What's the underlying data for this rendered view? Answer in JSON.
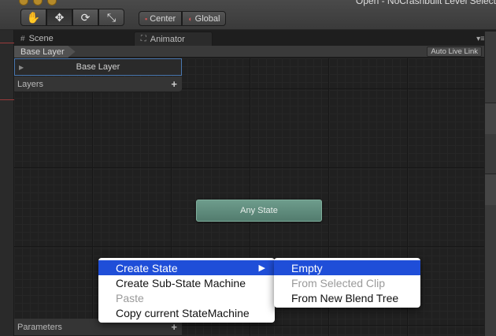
{
  "window": {
    "title_fragment": "Open - NoCrashbuilt Level Select"
  },
  "toolbar": {
    "tools": [
      {
        "name": "hand-tool",
        "glyph": "✋"
      },
      {
        "name": "move-tool",
        "glyph": "✥"
      },
      {
        "name": "rotate-tool",
        "glyph": "⟳"
      },
      {
        "name": "scale-tool",
        "glyph": "⤡"
      }
    ],
    "pivot_center": "Center",
    "pivot_global": "Global"
  },
  "tabs": {
    "scene": "Scene",
    "animator": "Animator"
  },
  "breadcrumb": {
    "layer": "Base Layer"
  },
  "auto_live_link": "Auto Live Link",
  "layers_panel": {
    "selected_layer": "Base Layer",
    "header": "Layers",
    "add": "+"
  },
  "parameters_panel": {
    "header": "Parameters",
    "add": "+"
  },
  "graph": {
    "any_state": "Any State"
  },
  "context_menu": {
    "items": [
      {
        "label": "Create State",
        "submenu": "▶"
      },
      {
        "label": "Create Sub-State Machine"
      },
      {
        "label": "Paste"
      },
      {
        "label": "Copy current StateMachine"
      }
    ]
  },
  "submenu": {
    "items": [
      {
        "label": "Empty"
      },
      {
        "label": "From Selected Clip"
      },
      {
        "label": "From New Blend Tree"
      }
    ]
  },
  "colors": {
    "menu_highlight": "#1f4ed8",
    "state_node": "#5f8c7c",
    "layer_border": "#4a78b0"
  }
}
